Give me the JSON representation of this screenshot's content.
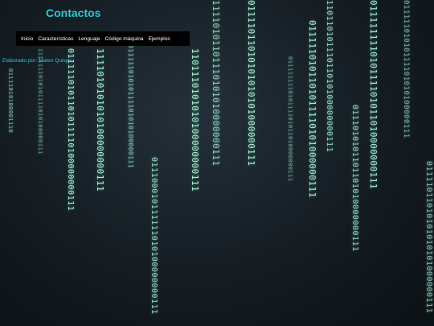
{
  "header": {
    "title": "Contactos"
  },
  "nav": {
    "items": [
      {
        "label": "Inicio"
      },
      {
        "label": "Características"
      },
      {
        "label": "Lenguaje"
      },
      {
        "label": "Código máquina"
      },
      {
        "label": "Ejemplos"
      }
    ]
  },
  "credit": {
    "text": "Elaborado por: Mateo Quispe"
  },
  "background": {
    "binary_streams": [
      "01111010100001110",
      "1111111010101111010100000111",
      "0111110101101011110100000000111",
      "1111010101010100000000111",
      "01111101010111101010100000111",
      "011100010111111010100000000111",
      "1101110101010100000000111",
      "11110101101110101010000000111",
      "01111011010101010101000000111",
      "011111111010111101011010000000111",
      "0111110101101011110101000000111",
      "11011010111011010100000000111",
      "0111010101101101010000000111"
    ]
  }
}
